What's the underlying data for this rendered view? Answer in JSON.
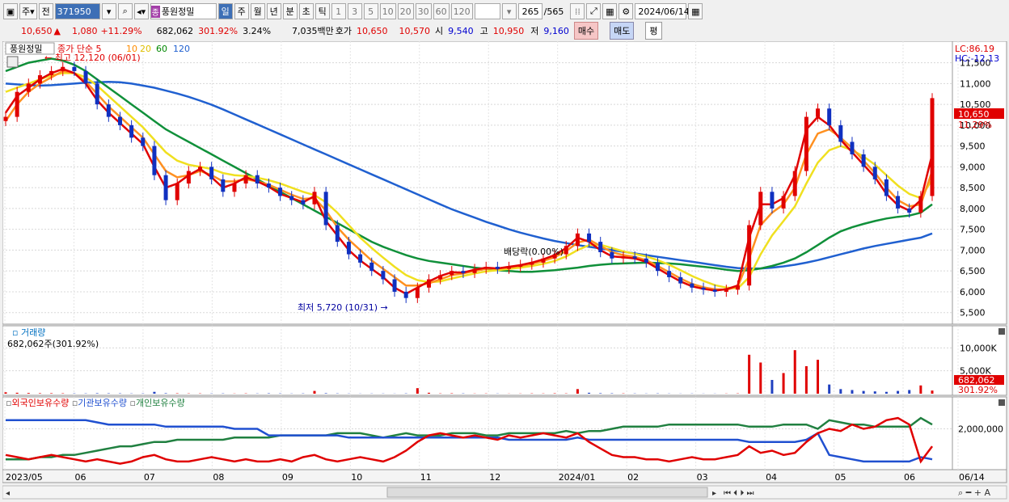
{
  "toolbar": {
    "type_label": "주",
    "prev_label": "전",
    "code": "371950",
    "jong": "종",
    "name": "풍원정밀",
    "periods": [
      "일",
      "주",
      "월",
      "년",
      "분",
      "초",
      "틱"
    ],
    "active_period": "일",
    "ticks": [
      "1",
      "3",
      "5",
      "10",
      "20",
      "30",
      "60",
      "120"
    ],
    "count": "265",
    "total": "/565",
    "date": "2024/06/14"
  },
  "info": {
    "price": "10,650",
    "arrow": "▲",
    "change": "1,080",
    "change_pct": "+11.29%",
    "volume": "682,062",
    "vol_ratio": "301.92%",
    "turnover": "3.24%",
    "amount": "7,035백만",
    "quote_label": "호가",
    "ask": "10,650",
    "bid": "10,570",
    "open_label": "시",
    "open": "9,540",
    "high_label": "고",
    "high": "10,950",
    "low_label": "저",
    "low": "9,160",
    "buy": "매수",
    "sell": "매도",
    "avg": "평"
  },
  "legend": {
    "name": "풍원정밀",
    "ma_label": "종가 단순 5",
    "ma10": "10",
    "ma20": "20",
    "ma60": "60",
    "ma120": "120"
  },
  "annotations": {
    "high": "최고 12,120 (06/01)",
    "low": "최저 5,720 (10/31)",
    "dividend": "배당락(0.00%)",
    "lc": "LC:86.19",
    "hc": "HC:-12.13",
    "price_tag": "10,650",
    "pct_tag": "11.29%"
  },
  "volume_panel": {
    "title": "거래량",
    "value": "682,062주(301.92%)",
    "tag": "682,062",
    "tag_pct": "301.92%"
  },
  "holder_panel": {
    "foreign": "외국인보유수량",
    "inst": "기관보유수량",
    "individual": "개인보유수량"
  },
  "chart_data": {
    "type": "candlestick",
    "price_ticks": [
      "11,500",
      "11,000",
      "10,500",
      "10,000",
      "9,500",
      "9,000",
      "8,500",
      "8,000",
      "7,500",
      "7,000",
      "6,500",
      "6,000",
      "5,500"
    ],
    "price_range": [
      5300,
      11900
    ],
    "volume_ticks": [
      "10,000K",
      "5,000K"
    ],
    "holder_ticks": [
      "2,000,000"
    ],
    "x_labels": [
      "2023/05",
      "06",
      "07",
      "08",
      "09",
      "10",
      "11",
      "12",
      "2024/01",
      "02",
      "03",
      "04",
      "05",
      "06",
      "06/14"
    ],
    "close_series": [
      10200,
      10800,
      11000,
      11200,
      11300,
      11400,
      11300,
      11000,
      10500,
      10200,
      10000,
      9700,
      9500,
      8800,
      8200,
      8600,
      8900,
      9000,
      8700,
      8400,
      8600,
      8800,
      8600,
      8500,
      8300,
      8200,
      8100,
      8400,
      7600,
      7200,
      6900,
      6700,
      6500,
      6300,
      6000,
      5850,
      6100,
      6300,
      6400,
      6500,
      6450,
      6550,
      6600,
      6550,
      6600,
      6650,
      6700,
      6800,
      6900,
      7100,
      7400,
      7200,
      6950,
      6800,
      6850,
      6800,
      6700,
      6500,
      6350,
      6200,
      6100,
      6050,
      6000,
      6050,
      6150,
      7600,
      8400,
      8000,
      8300,
      8900,
      10200,
      10400,
      10000,
      9600,
      9300,
      9000,
      8700,
      8300,
      8000,
      7900,
      8300,
      10650
    ],
    "ma5_series": [
      10300,
      10700,
      10900,
      11100,
      11250,
      11350,
      11250,
      11000,
      10600,
      10300,
      10050,
      9800,
      9550,
      9000,
      8500,
      8600,
      8800,
      8950,
      8750,
      8500,
      8600,
      8750,
      8650,
      8520,
      8350,
      8250,
      8150,
      8300,
      7700,
      7350,
      7000,
      6750,
      6550,
      6350,
      6100,
      5950,
      6100,
      6250,
      6380,
      6470,
      6460,
      6530,
      6580,
      6560,
      6600,
      6640,
      6700,
      6780,
      6880,
      7050,
      7300,
      7200,
      7000,
      6850,
      6830,
      6800,
      6720,
      6560,
      6400,
      6250,
      6130,
      6070,
      6030,
      6060,
      6150,
      7300,
      8100,
      8100,
      8250,
      8800,
      9900,
      10200,
      10000,
      9650,
      9350,
      9050,
      8750,
      8350,
      8080,
      7950,
      8200,
      9300
    ],
    "ma10_series": [
      10100,
      10500,
      10800,
      11000,
      11150,
      11300,
      11250,
      11050,
      10750,
      10450,
      10200,
      9950,
      9700,
      9300,
      8900,
      8750,
      8800,
      8900,
      8800,
      8650,
      8650,
      8700,
      8650,
      8570,
      8450,
      8330,
      8230,
      8250,
      7950,
      7550,
      7250,
      7000,
      6750,
      6550,
      6350,
      6150,
      6150,
      6200,
      6300,
      6400,
      6440,
      6500,
      6550,
      6560,
      6580,
      6620,
      6670,
      6740,
      6830,
      6980,
      7180,
      7250,
      7100,
      6950,
      6880,
      6840,
      6760,
      6620,
      6470,
      6320,
      6190,
      6110,
      6060,
      6050,
      6120,
      6800,
      7600,
      7900,
      8100,
      8500,
      9300,
      9800,
      9900,
      9700,
      9450,
      9150,
      8850,
      8500,
      8200,
      8050,
      8100,
      8900
    ],
    "ma20_series": [
      10800,
      10900,
      11000,
      11100,
      11200,
      11250,
      11250,
      11150,
      10950,
      10700,
      10450,
      10200,
      9950,
      9650,
      9350,
      9150,
      9050,
      9000,
      8950,
      8850,
      8800,
      8780,
      8740,
      8680,
      8600,
      8500,
      8400,
      8320,
      8150,
      7900,
      7600,
      7300,
      7050,
      6820,
      6600,
      6400,
      6280,
      6230,
      6250,
      6320,
      6380,
      6440,
      6490,
      6520,
      6550,
      6580,
      6620,
      6670,
      6740,
      6850,
      7000,
      7120,
      7130,
      7050,
      6970,
      6910,
      6850,
      6760,
      6650,
      6520,
      6380,
      6260,
      6160,
      6100,
      6080,
      6350,
      6900,
      7350,
      7700,
      8050,
      8600,
      9100,
      9400,
      9500,
      9400,
      9250,
      9050,
      8800,
      8550,
      8350,
      8250,
      8700
    ],
    "ma60_series": [
      11300,
      11400,
      11500,
      11550,
      11600,
      11550,
      11450,
      11300,
      11100,
      10900,
      10700,
      10500,
      10300,
      10100,
      9900,
      9750,
      9600,
      9450,
      9300,
      9150,
      9000,
      8850,
      8700,
      8550,
      8400,
      8250,
      8100,
      7950,
      7800,
      7650,
      7500,
      7350,
      7200,
      7080,
      6980,
      6880,
      6800,
      6740,
      6700,
      6660,
      6620,
      6580,
      6550,
      6520,
      6500,
      6480,
      6480,
      6500,
      6520,
      6550,
      6580,
      6620,
      6650,
      6670,
      6680,
      6690,
      6700,
      6690,
      6680,
      6660,
      6630,
      6600,
      6570,
      6530,
      6500,
      6520,
      6560,
      6620,
      6700,
      6800,
      6950,
      7120,
      7300,
      7450,
      7550,
      7630,
      7700,
      7760,
      7800,
      7830,
      7900,
      8100
    ],
    "ma120_series": [
      11000,
      10980,
      10960,
      10950,
      10960,
      10980,
      11000,
      11020,
      11030,
      11040,
      11030,
      11000,
      10950,
      10900,
      10830,
      10760,
      10680,
      10590,
      10490,
      10380,
      10260,
      10140,
      10020,
      9900,
      9780,
      9660,
      9540,
      9420,
      9300,
      9180,
      9060,
      8940,
      8820,
      8700,
      8580,
      8460,
      8340,
      8220,
      8100,
      7980,
      7880,
      7780,
      7680,
      7590,
      7500,
      7420,
      7350,
      7280,
      7220,
      7170,
      7120,
      7080,
      7040,
      7000,
      6960,
      6920,
      6880,
      6840,
      6800,
      6760,
      6720,
      6680,
      6640,
      6600,
      6570,
      6560,
      6560,
      6580,
      6610,
      6650,
      6700,
      6760,
      6830,
      6900,
      6970,
      7040,
      7100,
      7150,
      7200,
      7250,
      7300,
      7400
    ],
    "volume_spikes_k": [
      300,
      200,
      150,
      100,
      100,
      80,
      60,
      60,
      100,
      80,
      70,
      50,
      60,
      400,
      100,
      80,
      60,
      60,
      50,
      60,
      40,
      60,
      50,
      80,
      60,
      40,
      60,
      600,
      100,
      60,
      40,
      30,
      40,
      40,
      30,
      60,
      1200,
      200,
      60,
      80,
      60,
      40,
      50,
      40,
      30,
      40,
      60,
      50,
      80,
      60,
      1000,
      200,
      100,
      80,
      60,
      50,
      40,
      60,
      40,
      30,
      40,
      30,
      30,
      40,
      60,
      8500,
      6800,
      3000,
      4500,
      9500,
      6000,
      7400,
      2000,
      1000,
      800,
      600,
      500,
      400,
      600,
      800,
      1800,
      682
    ],
    "foreign_series": [
      0.6,
      0.5,
      0.4,
      0.5,
      0.6,
      0.5,
      0.4,
      0.3,
      0.4,
      0.3,
      0.2,
      0.3,
      0.5,
      0.6,
      0.4,
      0.3,
      0.3,
      0.4,
      0.5,
      0.4,
      0.3,
      0.4,
      0.3,
      0.3,
      0.4,
      0.3,
      0.5,
      0.6,
      0.4,
      0.3,
      0.4,
      0.5,
      0.4,
      0.3,
      0.5,
      0.8,
      1.2,
      1.5,
      1.6,
      1.5,
      1.4,
      1.5,
      1.4,
      1.3,
      1.5,
      1.4,
      1.5,
      1.6,
      1.5,
      1.4,
      1.6,
      1.2,
      0.9,
      0.6,
      0.5,
      0.5,
      0.4,
      0.4,
      0.3,
      0.4,
      0.5,
      0.4,
      0.4,
      0.5,
      0.6,
      1.0,
      0.7,
      0.8,
      0.6,
      0.7,
      1.2,
      1.6,
      1.8,
      1.7,
      2.0,
      1.8,
      1.9,
      2.2,
      2.3,
      2.0,
      0.3,
      1.0
    ],
    "inst_series": [
      2.2,
      2.2,
      2.2,
      2.2,
      2.2,
      2.2,
      2.2,
      2.2,
      2.1,
      2.0,
      2.0,
      2.0,
      2.0,
      2.0,
      1.9,
      1.9,
      1.9,
      1.9,
      1.9,
      1.9,
      1.8,
      1.8,
      1.8,
      1.5,
      1.5,
      1.5,
      1.5,
      1.5,
      1.5,
      1.5,
      1.4,
      1.4,
      1.4,
      1.4,
      1.4,
      1.4,
      1.4,
      1.4,
      1.4,
      1.4,
      1.4,
      1.4,
      1.4,
      1.4,
      1.3,
      1.3,
      1.3,
      1.3,
      1.3,
      1.3,
      1.4,
      1.3,
      1.3,
      1.3,
      1.3,
      1.3,
      1.3,
      1.3,
      1.3,
      1.3,
      1.3,
      1.3,
      1.3,
      1.3,
      1.3,
      1.2,
      1.2,
      1.2,
      1.2,
      1.2,
      1.3,
      1.6,
      0.6,
      0.5,
      0.4,
      0.3,
      0.3,
      0.3,
      0.3,
      0.3,
      0.5,
      0.4
    ],
    "indiv_series": [
      0.4,
      0.4,
      0.4,
      0.5,
      0.5,
      0.6,
      0.6,
      0.7,
      0.8,
      0.9,
      1.0,
      1.0,
      1.1,
      1.2,
      1.2,
      1.3,
      1.3,
      1.3,
      1.3,
      1.3,
      1.4,
      1.4,
      1.4,
      1.4,
      1.5,
      1.5,
      1.5,
      1.5,
      1.5,
      1.6,
      1.6,
      1.6,
      1.5,
      1.4,
      1.5,
      1.6,
      1.5,
      1.5,
      1.5,
      1.6,
      1.6,
      1.6,
      1.5,
      1.5,
      1.6,
      1.6,
      1.6,
      1.6,
      1.6,
      1.7,
      1.6,
      1.7,
      1.7,
      1.8,
      1.9,
      1.9,
      1.9,
      1.9,
      2.0,
      2.0,
      2.0,
      2.0,
      2.0,
      2.0,
      2.0,
      1.9,
      1.9,
      1.9,
      2.0,
      2.0,
      2.0,
      1.8,
      2.2,
      2.1,
      2.0,
      2.0,
      1.9,
      1.9,
      1.9,
      1.9,
      2.3,
      2.0
    ]
  }
}
